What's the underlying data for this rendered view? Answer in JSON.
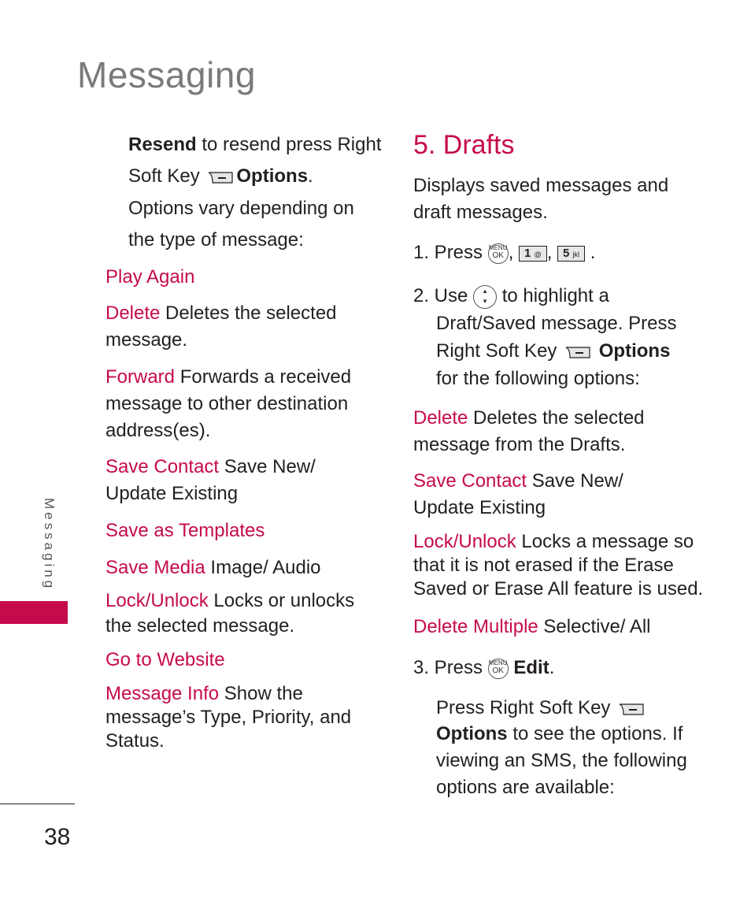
{
  "accent": "#c60b4d",
  "header": {
    "title": "Messaging"
  },
  "side": {
    "label": "Messaging",
    "page_number": "38"
  },
  "left": {
    "resend": {
      "term": "Resend",
      "text1": " to resend press Right",
      "text2": "Soft Key",
      "options": "Options",
      "period": ".",
      "text3": "Options vary depending on",
      "text4": "the type of message:"
    },
    "items": [
      {
        "term": "Play Again",
        "desc": ""
      },
      {
        "term": "Delete",
        "desc": " Deletes the selected",
        "desc2": "message."
      },
      {
        "term": "Forward",
        "desc": " Forwards a received",
        "desc2": "message to other destination",
        "desc3": "address(es)."
      },
      {
        "term": "Save Contact",
        "desc": " Save New/",
        "desc2": "Update Existing"
      },
      {
        "term": "Save as Templates",
        "desc": ""
      },
      {
        "term": "Save Media",
        "desc": " Image/ Audio"
      },
      {
        "term": "Lock/Unlock",
        "desc": " Locks or unlocks",
        "desc2": "the selected message."
      },
      {
        "term": "Go to Website",
        "desc": ""
      },
      {
        "term": "Message Info",
        "desc": " Show the",
        "desc2": "message’s Type, Priority, and",
        "desc3": "Status."
      }
    ]
  },
  "right": {
    "section_title": "5. Drafts",
    "intro1": "Displays saved messages and",
    "intro2": "draft messages.",
    "step1": {
      "label": "1. Press",
      "ok_top": "MENU",
      "ok_bottom": "OK",
      "key1": "1",
      "key1_sub": "@",
      "key2": "5",
      "key2_sub": "jkl",
      "sep": ",",
      "end": "."
    },
    "step2": {
      "label": "2. Use",
      "text1": "to highlight a",
      "text2": "Draft/Saved message. Press",
      "text3": "Right Soft Key",
      "options": "Options",
      "text4": "for the following options:"
    },
    "items": [
      {
        "term": "Delete",
        "desc": " Deletes the selected",
        "desc2": "message from the Drafts."
      },
      {
        "term": "Save Contact",
        "desc": " Save New/",
        "desc2": "Update Existing"
      },
      {
        "term": "Lock/Unlock",
        "desc": " Locks a message so",
        "desc2": "that it is not erased if the Erase",
        "desc3": "Saved or Erase All feature is used."
      },
      {
        "term": "Delete Multiple",
        "desc": " Selective/ All"
      }
    ],
    "step3": {
      "label": "3. Press",
      "edit": "Edit",
      "period": "."
    },
    "step3b": {
      "text1": "Press Right Soft Key",
      "options": "Options",
      "text2": " to see the options. If",
      "text3": "viewing an SMS, the following",
      "text4": "options are available:"
    }
  }
}
